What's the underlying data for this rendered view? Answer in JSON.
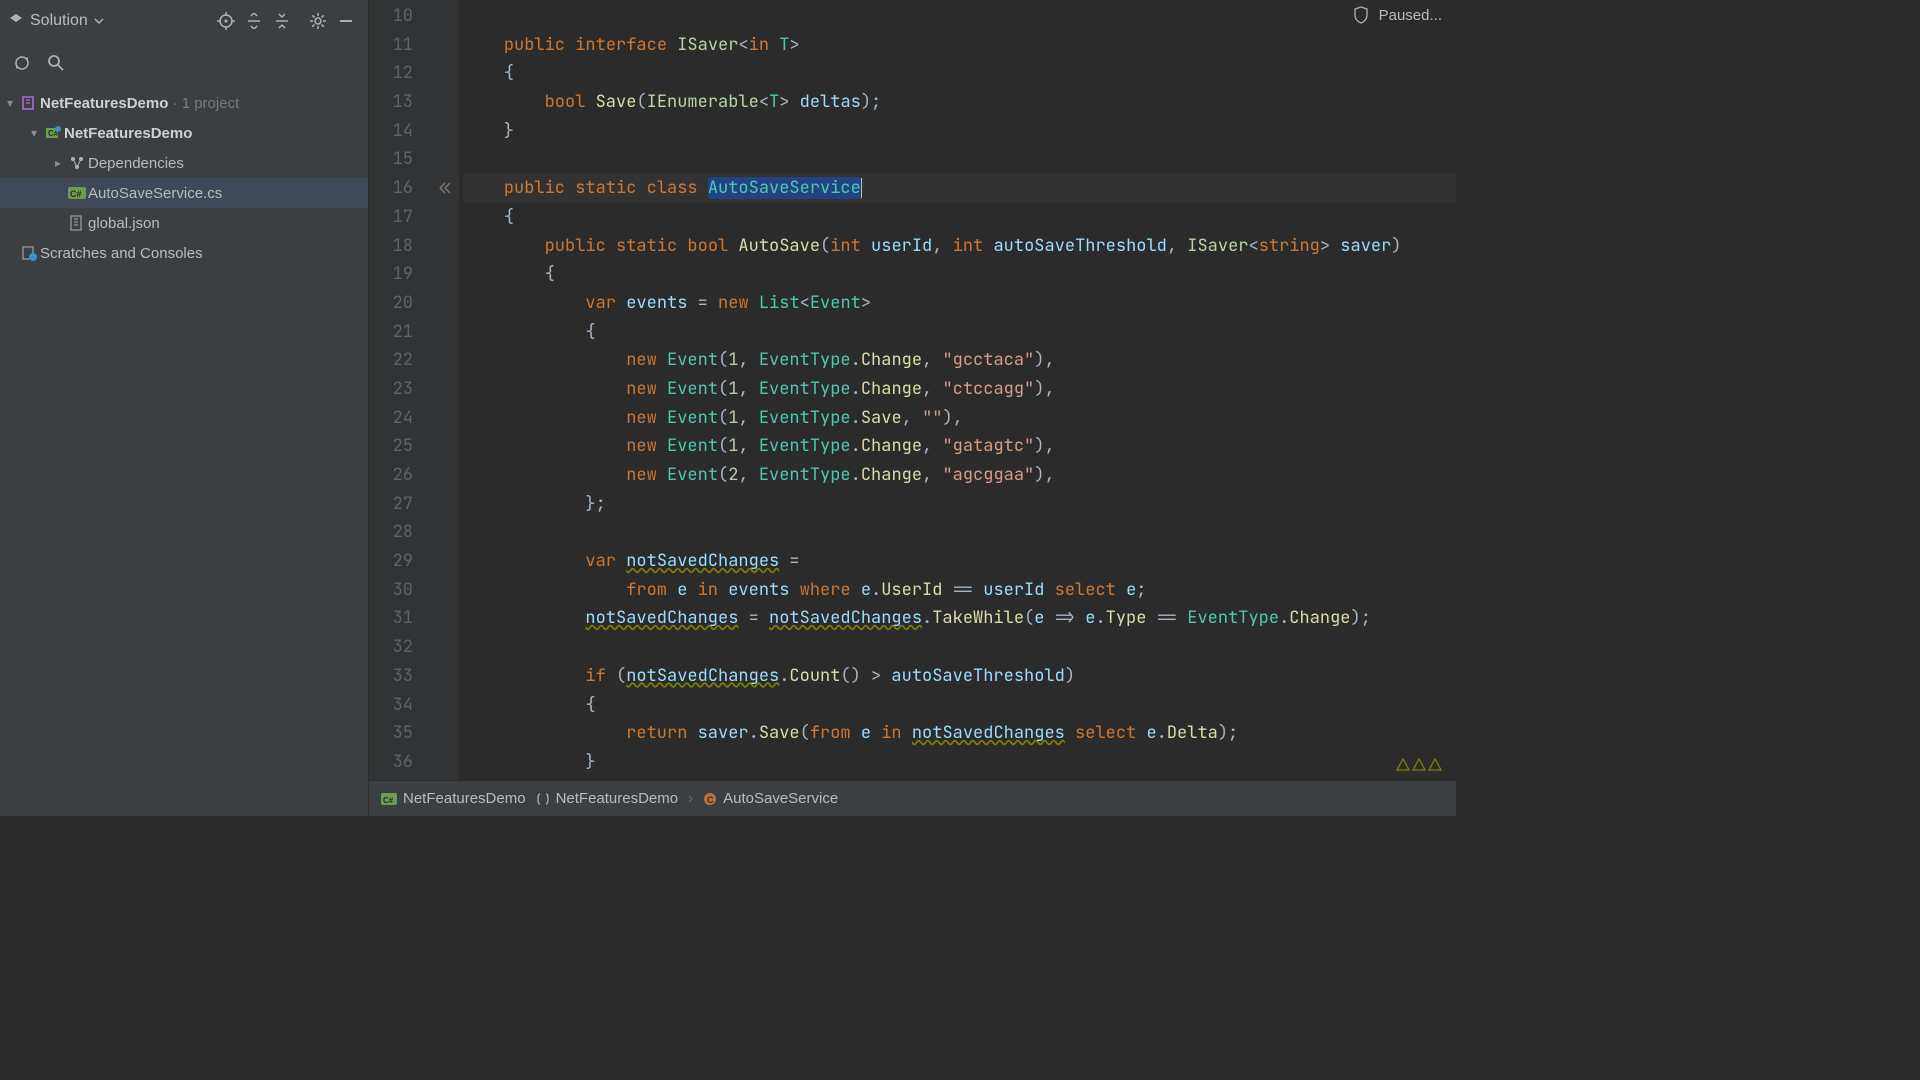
{
  "sidebar": {
    "title": "Solution",
    "solutionName": "NetFeaturesDemo",
    "projectCount": "· 1 project",
    "projectName": "NetFeaturesDemo",
    "deps": "Dependencies",
    "file1": "AutoSaveService.cs",
    "file2": "global.json",
    "scratches": "Scratches and Consoles"
  },
  "status": {
    "text": "Paused..."
  },
  "breadcrumb": {
    "proj": "NetFeaturesDemo",
    "ns": "NetFeaturesDemo",
    "cls": "AutoSaveService"
  },
  "code": {
    "startLine": 10,
    "currentLine": 16,
    "lines": [
      [],
      [
        {
          "c": "kw",
          "t": "public "
        },
        {
          "c": "kw",
          "t": "interface "
        },
        {
          "c": "typeI",
          "t": "ISaver"
        },
        {
          "t": "<"
        },
        {
          "c": "kw",
          "t": "in "
        },
        {
          "c": "type",
          "t": "T"
        },
        {
          "t": ">"
        }
      ],
      [
        {
          "t": "{"
        }
      ],
      [
        {
          "t": "    "
        },
        {
          "c": "kw",
          "t": "bool "
        },
        {
          "c": "method",
          "t": "Save"
        },
        {
          "t": "("
        },
        {
          "c": "typeI",
          "t": "IEnumerable"
        },
        {
          "t": "<"
        },
        {
          "c": "type",
          "t": "T"
        },
        {
          "t": "> "
        },
        {
          "c": "param",
          "t": "deltas"
        },
        {
          "t": ");"
        }
      ],
      [
        {
          "t": "}"
        }
      ],
      [],
      [
        {
          "c": "kw",
          "t": "public "
        },
        {
          "c": "kw",
          "t": "static "
        },
        {
          "c": "kw",
          "t": "class "
        },
        {
          "c": "type hl",
          "t": "AutoSaveService"
        },
        {
          "cursor": true
        }
      ],
      [
        {
          "t": "{"
        }
      ],
      [
        {
          "t": "    "
        },
        {
          "c": "kw",
          "t": "public "
        },
        {
          "c": "kw",
          "t": "static "
        },
        {
          "c": "kw",
          "t": "bool "
        },
        {
          "c": "method",
          "t": "AutoSave"
        },
        {
          "t": "("
        },
        {
          "c": "kw",
          "t": "int "
        },
        {
          "c": "param",
          "t": "userId"
        },
        {
          "t": ", "
        },
        {
          "c": "kw",
          "t": "int "
        },
        {
          "c": "param",
          "t": "autoSaveThreshold"
        },
        {
          "t": ", "
        },
        {
          "c": "typeI",
          "t": "ISaver"
        },
        {
          "t": "<"
        },
        {
          "c": "kw",
          "t": "string"
        },
        {
          "t": "> "
        },
        {
          "c": "param",
          "t": "saver"
        },
        {
          "t": ")"
        }
      ],
      [
        {
          "t": "    {"
        }
      ],
      [
        {
          "t": "        "
        },
        {
          "c": "kw",
          "t": "var "
        },
        {
          "c": "param",
          "t": "events"
        },
        {
          "t": " = "
        },
        {
          "c": "kw",
          "t": "new "
        },
        {
          "c": "type",
          "t": "List"
        },
        {
          "t": "<"
        },
        {
          "c": "type",
          "t": "Event"
        },
        {
          "t": ">"
        }
      ],
      [
        {
          "t": "        {"
        }
      ],
      [
        {
          "t": "            "
        },
        {
          "c": "kw",
          "t": "new "
        },
        {
          "c": "type",
          "t": "Event"
        },
        {
          "t": "("
        },
        {
          "c": "num",
          "t": "1"
        },
        {
          "t": ", "
        },
        {
          "c": "type",
          "t": "EventType"
        },
        {
          "t": "."
        },
        {
          "c": "field",
          "t": "Change"
        },
        {
          "t": ", "
        },
        {
          "c": "str",
          "t": "\"gcctaca\""
        },
        {
          "t": "),"
        }
      ],
      [
        {
          "t": "            "
        },
        {
          "c": "kw",
          "t": "new "
        },
        {
          "c": "type",
          "t": "Event"
        },
        {
          "t": "("
        },
        {
          "c": "num",
          "t": "1"
        },
        {
          "t": ", "
        },
        {
          "c": "type",
          "t": "EventType"
        },
        {
          "t": "."
        },
        {
          "c": "field",
          "t": "Change"
        },
        {
          "t": ", "
        },
        {
          "c": "str",
          "t": "\"ctccagg\""
        },
        {
          "t": "),"
        }
      ],
      [
        {
          "t": "            "
        },
        {
          "c": "kw",
          "t": "new "
        },
        {
          "c": "type",
          "t": "Event"
        },
        {
          "t": "("
        },
        {
          "c": "num",
          "t": "1"
        },
        {
          "t": ", "
        },
        {
          "c": "type",
          "t": "EventType"
        },
        {
          "t": "."
        },
        {
          "c": "field",
          "t": "Save"
        },
        {
          "t": ", "
        },
        {
          "c": "str",
          "t": "\"\""
        },
        {
          "t": "),"
        }
      ],
      [
        {
          "t": "            "
        },
        {
          "c": "kw",
          "t": "new "
        },
        {
          "c": "type",
          "t": "Event"
        },
        {
          "t": "("
        },
        {
          "c": "num",
          "t": "1"
        },
        {
          "t": ", "
        },
        {
          "c": "type",
          "t": "EventType"
        },
        {
          "t": "."
        },
        {
          "c": "field",
          "t": "Change"
        },
        {
          "t": ", "
        },
        {
          "c": "str",
          "t": "\"gatagtc\""
        },
        {
          "t": "),"
        }
      ],
      [
        {
          "t": "            "
        },
        {
          "c": "kw",
          "t": "new "
        },
        {
          "c": "type",
          "t": "Event"
        },
        {
          "t": "("
        },
        {
          "c": "num",
          "t": "2"
        },
        {
          "t": ", "
        },
        {
          "c": "type",
          "t": "EventType"
        },
        {
          "t": "."
        },
        {
          "c": "field",
          "t": "Change"
        },
        {
          "t": ", "
        },
        {
          "c": "str",
          "t": "\"agcggaa\""
        },
        {
          "t": "),"
        }
      ],
      [
        {
          "t": "        };"
        }
      ],
      [],
      [
        {
          "t": "        "
        },
        {
          "c": "kw",
          "t": "var "
        },
        {
          "c": "param warn",
          "t": "notSavedChanges"
        },
        {
          "t": " ="
        }
      ],
      [
        {
          "t": "            "
        },
        {
          "c": "kw",
          "t": "from "
        },
        {
          "c": "param",
          "t": "e"
        },
        {
          "c": "kw",
          "t": " in "
        },
        {
          "c": "param",
          "t": "events"
        },
        {
          "c": "kw",
          "t": " where "
        },
        {
          "c": "param",
          "t": "e"
        },
        {
          "t": "."
        },
        {
          "c": "field",
          "t": "UserId"
        },
        {
          "t": " == "
        },
        {
          "c": "param",
          "t": "userId"
        },
        {
          "c": "kw",
          "t": " select "
        },
        {
          "c": "param",
          "t": "e"
        },
        {
          "t": ";"
        }
      ],
      [
        {
          "t": "        "
        },
        {
          "c": "param warn",
          "t": "notSavedChanges"
        },
        {
          "t": " = "
        },
        {
          "c": "param warn",
          "t": "notSavedChanges"
        },
        {
          "t": "."
        },
        {
          "c": "method",
          "t": "TakeWhile"
        },
        {
          "t": "("
        },
        {
          "c": "param",
          "t": "e"
        },
        {
          "t": " => "
        },
        {
          "c": "param",
          "t": "e"
        },
        {
          "t": "."
        },
        {
          "c": "field",
          "t": "Type"
        },
        {
          "t": " == "
        },
        {
          "c": "type",
          "t": "EventType"
        },
        {
          "t": "."
        },
        {
          "c": "field",
          "t": "Change"
        },
        {
          "t": ");"
        }
      ],
      [],
      [
        {
          "t": "        "
        },
        {
          "c": "kw",
          "t": "if "
        },
        {
          "t": "("
        },
        {
          "c": "param warn",
          "t": "notSavedChanges"
        },
        {
          "t": "."
        },
        {
          "c": "method",
          "t": "Count"
        },
        {
          "t": "() > "
        },
        {
          "c": "param",
          "t": "autoSaveThreshold"
        },
        {
          "t": ")"
        }
      ],
      [
        {
          "t": "        {"
        }
      ],
      [
        {
          "t": "            "
        },
        {
          "c": "kw",
          "t": "return "
        },
        {
          "c": "param",
          "t": "saver"
        },
        {
          "t": "."
        },
        {
          "c": "method",
          "t": "Save"
        },
        {
          "t": "("
        },
        {
          "c": "kw",
          "t": "from "
        },
        {
          "c": "param",
          "t": "e"
        },
        {
          "c": "kw",
          "t": " in "
        },
        {
          "c": "param warn",
          "t": "notSavedChanges"
        },
        {
          "c": "kw",
          "t": " select "
        },
        {
          "c": "param",
          "t": "e"
        },
        {
          "t": "."
        },
        {
          "c": "field",
          "t": "Delta"
        },
        {
          "t": ");"
        }
      ],
      [
        {
          "t": "        }"
        }
      ]
    ]
  }
}
